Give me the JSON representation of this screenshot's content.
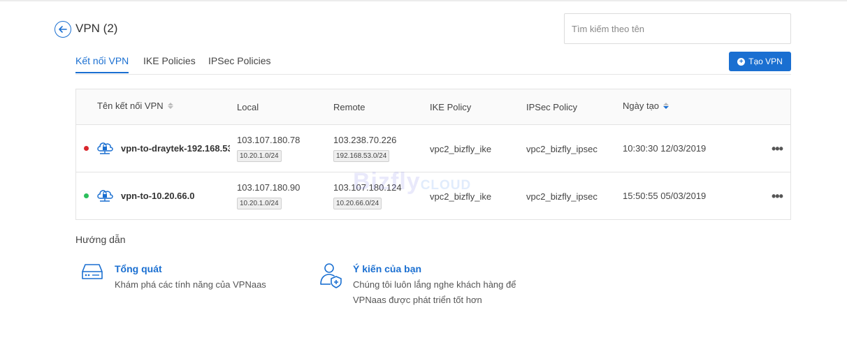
{
  "header": {
    "title": "VPN (2)",
    "search_placeholder": "Tìm kiếm theo tên"
  },
  "tabs": [
    {
      "label": "Kết nối VPN",
      "active": true
    },
    {
      "label": "IKE Policies",
      "active": false
    },
    {
      "label": "IPSec Policies",
      "active": false
    }
  ],
  "create_button": "Tạo VPN",
  "table": {
    "columns": [
      "Tên kết nối VPN",
      "Local",
      "Remote",
      "IKE Policy",
      "IPSec Policy",
      "Ngày tạo"
    ],
    "rows": [
      {
        "status": "red",
        "name": "vpn-to-draytek-192.168.53",
        "local_ip": "103.107.180.78",
        "local_subnet": "10.20.1.0/24",
        "remote_ip": "103.238.70.226",
        "remote_subnet": "192.168.53.0/24",
        "ike_policy": "vpc2_bizfly_ike",
        "ipsec_policy": "vpc2_bizfly_ipsec",
        "created": "10:30:30 12/03/2019"
      },
      {
        "status": "green",
        "name": "vpn-to-10.20.66.0",
        "local_ip": "103.107.180.90",
        "local_subnet": "10.20.1.0/24",
        "remote_ip": "103.107.180.124",
        "remote_subnet": "10.20.66.0/24",
        "ike_policy": "vpc2_bizfly_ike",
        "ipsec_policy": "vpc2_bizfly_ipsec",
        "created": "15:50:55 05/03/2019"
      }
    ]
  },
  "watermark": {
    "brand": "Bizfly",
    "suffix": "CLOUD"
  },
  "guide": {
    "title": "Hướng dẫn",
    "items": [
      {
        "icon": "server-icon",
        "title": "Tổng quát",
        "desc": "Khám phá các tính năng của VPNaas"
      },
      {
        "icon": "user-shield-icon",
        "title": "Ý kiến của bạn",
        "desc": "Chúng tôi luôn lắng nghe khách hàng để",
        "desc2": "VPNaas được phát triển tốt hơn"
      }
    ]
  },
  "colors": {
    "accent": "#1a6fd1",
    "status_red": "#d9262c",
    "status_green": "#2bbf5c"
  }
}
